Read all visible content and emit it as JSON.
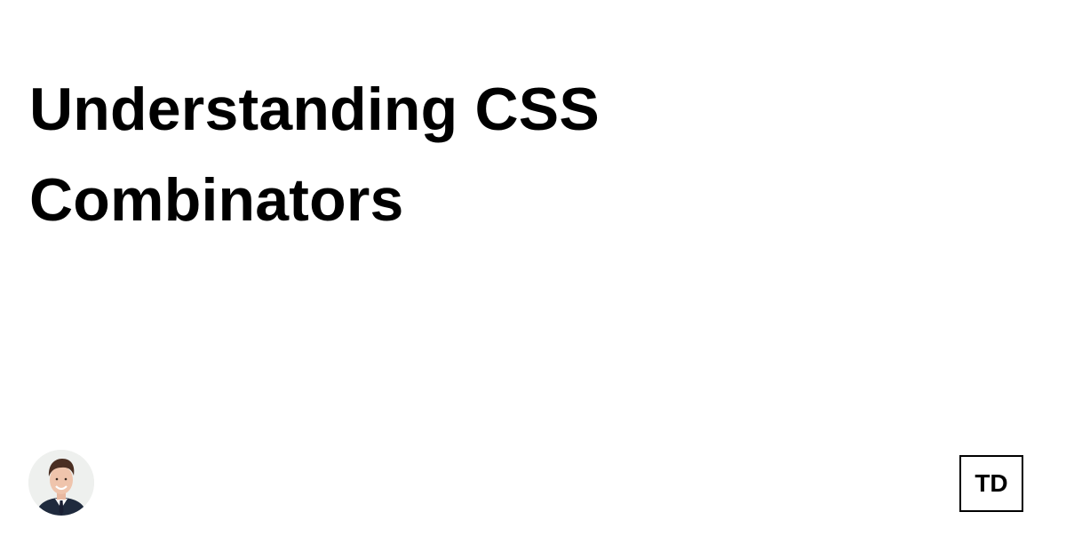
{
  "post": {
    "title": "Understanding CSS Combinators"
  },
  "author": {
    "avatar_icon": "author-avatar"
  },
  "brand": {
    "logo_text": "TD"
  },
  "colors": {
    "background": "#ffffff",
    "text": "#000000"
  }
}
